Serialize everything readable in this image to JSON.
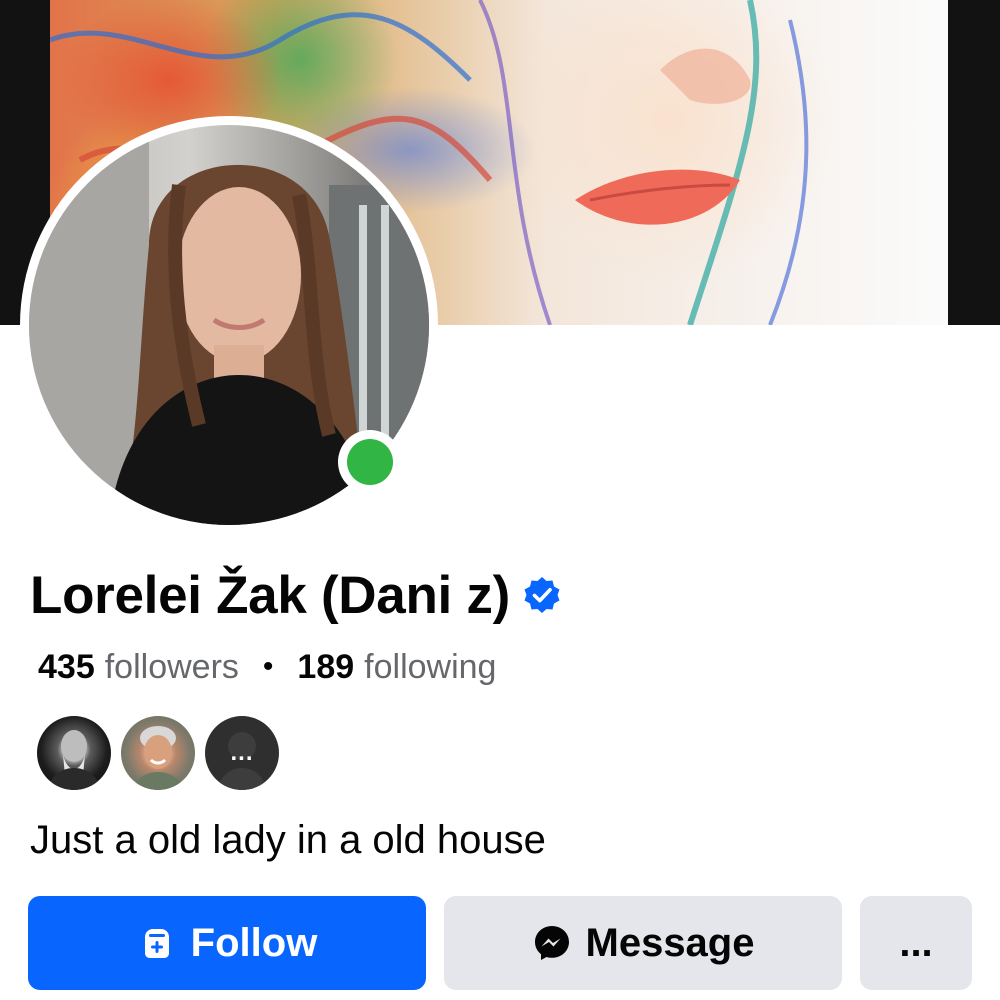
{
  "profile": {
    "name": "Lorelei Žak (Dani z)",
    "verified": true,
    "online": true,
    "followers_count": "435",
    "followers_label": "followers",
    "separator": "•",
    "following_count": "189",
    "following_label": "following",
    "bio": "Just a old lady in a old house"
  },
  "friends": {
    "more_label": "..."
  },
  "actions": {
    "follow_label": "Follow",
    "message_label": "Message",
    "more_label": "..."
  },
  "icons": {
    "verified": "verified-badge-icon",
    "follow": "follow-user-icon",
    "message": "messenger-icon",
    "more": "more-options-icon"
  },
  "colors": {
    "primary": "#0866ff",
    "secondary_button": "#e4e6eb",
    "online": "#31b545",
    "muted_text": "#65676b"
  }
}
